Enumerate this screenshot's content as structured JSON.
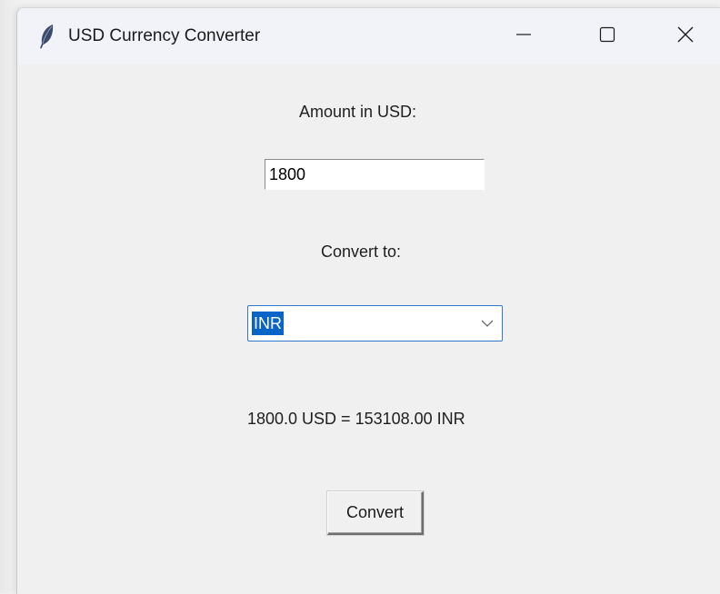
{
  "window": {
    "title": "USD Currency Converter",
    "app_icon": "feather-icon"
  },
  "titlebar_controls": {
    "minimize_icon": "minimize-icon",
    "maximize_icon": "maximize-icon",
    "close_icon": "close-icon"
  },
  "form": {
    "amount_label": "Amount in USD:",
    "amount_value": "1800",
    "convert_to_label": "Convert to:",
    "currency_selected": "INR",
    "result_text": "1800.0 USD = 153108.00 INR",
    "convert_button_label": "Convert"
  },
  "colors": {
    "selection_highlight": "#0a64c8",
    "combo_focus_border": "#2e78d4",
    "window_bg": "#f0f0f0"
  }
}
